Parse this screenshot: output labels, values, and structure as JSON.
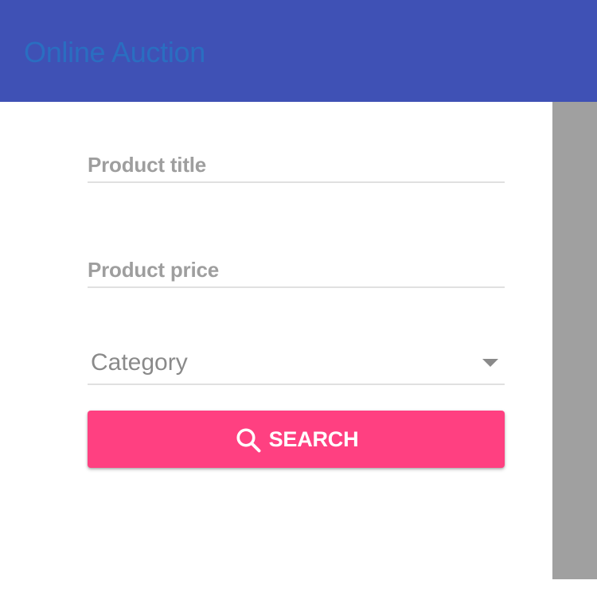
{
  "app_bar": {
    "title": "Online Auction",
    "background_color": "#3f51b5",
    "title_color": "#2a6ec1"
  },
  "form": {
    "product_title": {
      "label": "Product title",
      "value": ""
    },
    "product_price": {
      "label": "Product price",
      "value": ""
    },
    "category": {
      "selected": "Category",
      "icon": "caret-down-icon"
    },
    "search_button": {
      "label": "SEARCH",
      "icon": "search-icon",
      "color": "#ff4081"
    }
  },
  "side_panel": {
    "color": "#a0a0a0"
  }
}
